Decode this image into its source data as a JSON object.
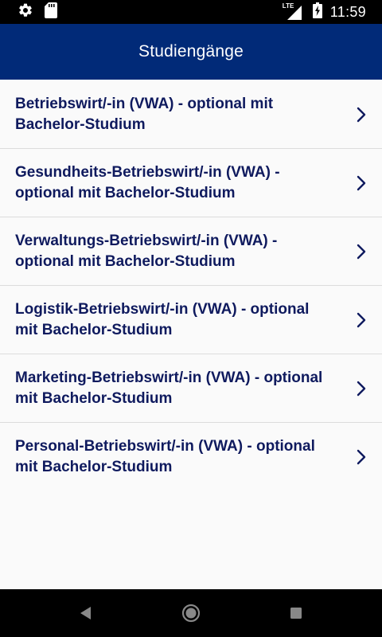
{
  "status_bar": {
    "time": "11:59",
    "network_label": "LTE",
    "icons": [
      "settings-gear-icon",
      "sd-card-icon",
      "lte-signal-icon",
      "battery-charging-icon"
    ]
  },
  "app_bar": {
    "title": "Studiengänge"
  },
  "list": {
    "items": [
      {
        "label": "Betriebswirt/-in (VWA) - optional mit Bachelor-Studium",
        "icon": "chevron-right-icon"
      },
      {
        "label": "Gesundheits-Betriebswirt/-in (VWA) - optional mit Bachelor-Studium",
        "icon": "chevron-right-icon"
      },
      {
        "label": "Verwaltungs-Betriebswirt/-in (VWA) - optional mit Bachelor-Studium",
        "icon": "chevron-right-icon"
      },
      {
        "label": "Logistik-Betriebswirt/-in (VWA) - optional mit Bachelor-Studium",
        "icon": "chevron-right-icon"
      },
      {
        "label": "Marketing-Betriebswirt/-in (VWA) - optional mit Bachelor-Studium",
        "icon": "chevron-right-icon"
      },
      {
        "label": "Personal-Betriebswirt/-in (VWA) - optional mit Bachelor-Studium",
        "icon": "chevron-right-icon"
      }
    ]
  },
  "nav_bar": {
    "buttons": [
      "back-icon",
      "home-icon",
      "recents-icon"
    ]
  },
  "colors": {
    "app_bar_bg": "#012a78",
    "item_text": "#0f1a5e",
    "background": "#fafafa",
    "divider": "#dcdcdc"
  }
}
